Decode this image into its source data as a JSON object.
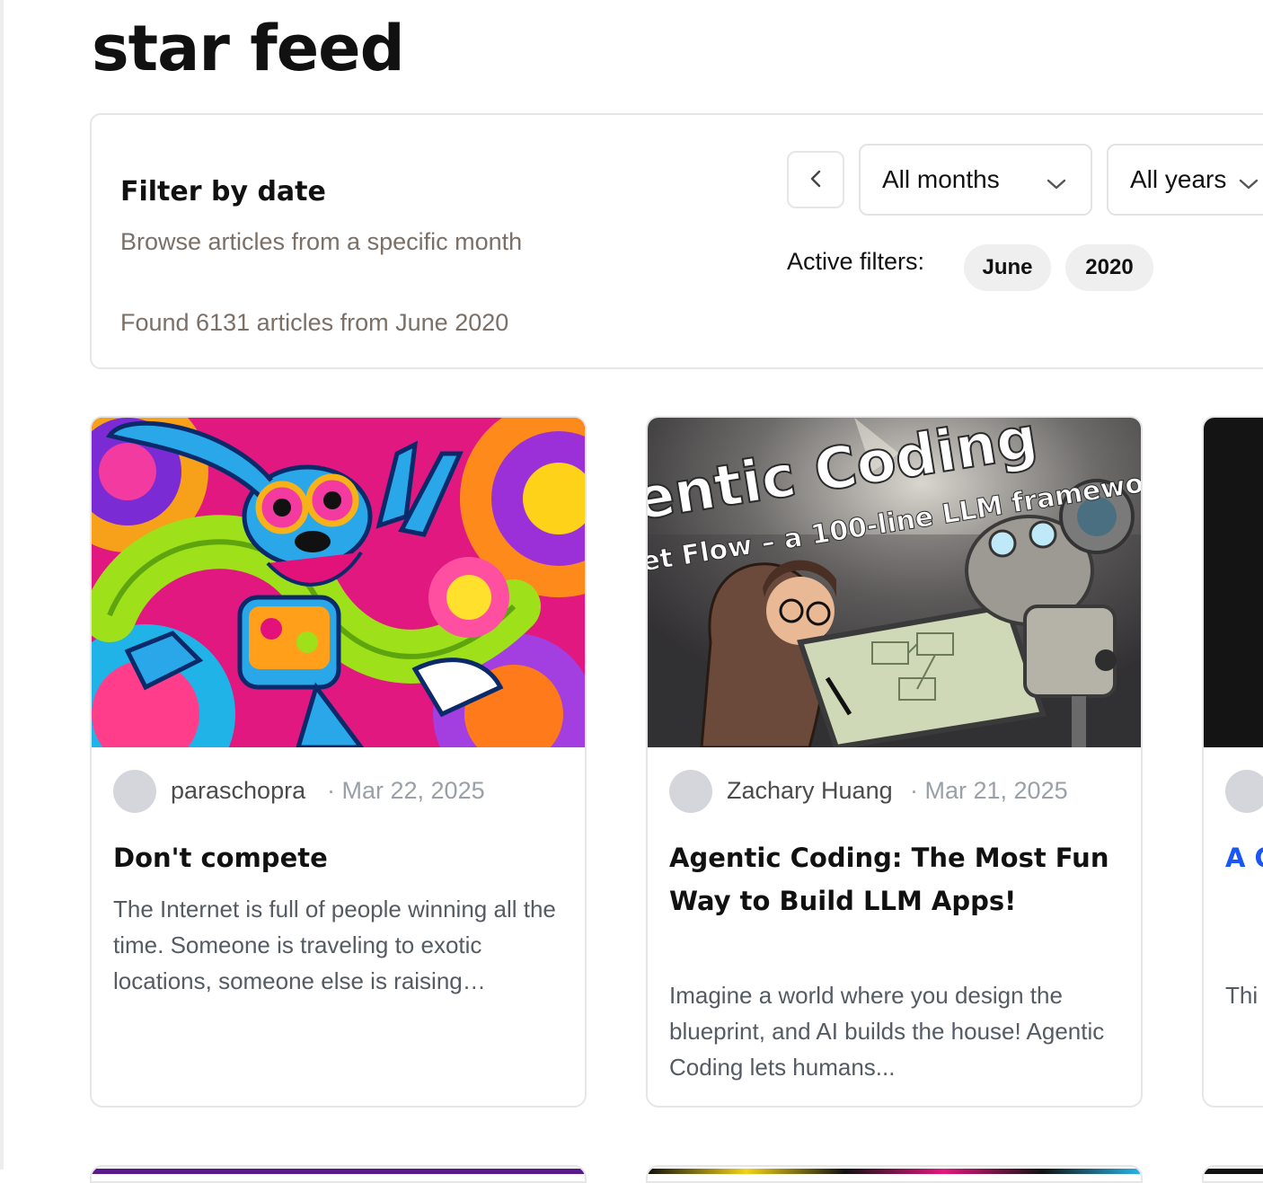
{
  "page": {
    "title": "star feed"
  },
  "filter": {
    "heading": "Filter by date",
    "subheading": "Browse articles from a specific month",
    "result_text": "Found 6131 articles from June 2020",
    "month_select": "All months",
    "year_select": "All years",
    "active_filters_label": "Active filters:",
    "active_filters": [
      "June",
      "2020"
    ]
  },
  "articles": [
    {
      "author": "paraschopra",
      "date": "Mar 22, 2025",
      "title": "Don't compete",
      "excerpt": "The Internet is full of people winning all the time. Someone is traveling to exotic locations, someone else is raising…"
    },
    {
      "author": "Zachary Huang",
      "date": "Mar 21, 2025",
      "title": "Agentic Coding: The Most Fun Way to Build LLM Apps!",
      "excerpt": "Imagine a world where you design the blueprint, and AI builds the house! Agentic Coding lets humans...",
      "image_text_line1": "entic Coding",
      "image_text_line2": "et Flow – a 100-line LLM framework"
    },
    {
      "title": "A C Sh Co",
      "excerpt": "Thi Pag"
    }
  ],
  "colors": {
    "card_border": "#e6e6e6",
    "chip_bg": "#efefef",
    "avatar": "#d4d6dc",
    "link_title": "#1a56f0",
    "muted_text": "#7a7068"
  },
  "icons": {
    "prev": "chevron-left-icon",
    "dropdown": "chevron-down-icon"
  }
}
